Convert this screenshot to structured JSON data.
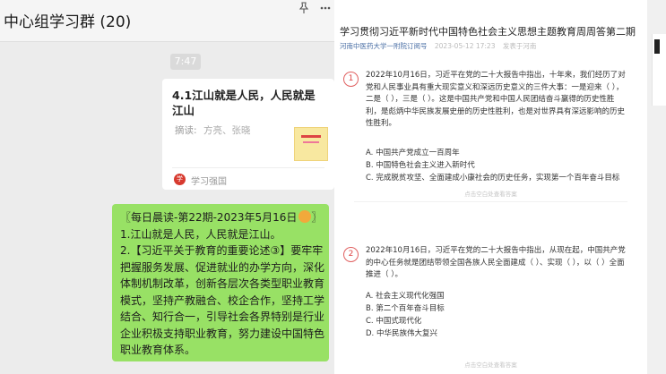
{
  "chat": {
    "title": "中心组学习群 (20)",
    "time": "7:47",
    "card": {
      "title": "4.1江山就是人民，人民就是江山",
      "desc_label": "摘读:",
      "desc": "方亮、张晓",
      "source_icon": "学",
      "source": "学习强国"
    },
    "message": {
      "line1": "〖每日晨读-第22期-2023年5月16日",
      "line1_end": "〗",
      "line2": "1.江山就是人民，人民就是江山。",
      "line3": "2.【习近平关于教育的重要论述③】要牢牢把握服务发展、促进就业的办学方向，深化体制机制改革，创新各层次各类型职业教育模式，坚持产教融合、校企合作，坚持工学结合、知行合一，引导社会各界特别是行业企业积极支持职业教育，努力建设中国特色职业教育体系。"
    }
  },
  "article": {
    "title": "学习贯彻习近平新时代中国特色社会主义思想主题教育周周答第二期",
    "author": "河南中医药大学一附院订阅号",
    "date": "2023-05-12 17:23",
    "location": "发表于河南",
    "questions": [
      {
        "num": "1",
        "text": "2022年10月16日，习近平在党的二十大报告中指出，十年来，我们经历了对党和人民事业具有重大现实意义和深远历史意义的三件大事：一是迎来（ ），二是（ ），三是（ ）。这是中国共产党和中国人民团结奋斗赢得的历史性胜利，是彪炳中华民族发展史册的历史性胜利，也是对世界具有深远影响的历史性胜利。",
        "options": [
          "A. 中国共产党成立一百周年",
          "B. 中国特色社会主义进入新时代",
          "C. 完成脱贫攻坚、全面建成小康社会的历史任务，实现第一个百年奋斗目标"
        ],
        "hint": "点击空白处查看答案"
      },
      {
        "num": "2",
        "text": "2022年10月16日，习近平在党的二十大报告中指出，从现在起，中国共产党的中心任务就是团结带领全国各族人民全面建成（ ）、实现（ ），以（ ）全面推进（ ）。",
        "options": [
          "A. 社会主义现代化强国",
          "B. 第二个百年奋斗目标",
          "C. 中国式现代化",
          "D. 中华民族伟大复兴"
        ],
        "hint": "点击空白处查看答案"
      }
    ]
  },
  "colors": {
    "chat_bg": "#ececec",
    "bubble_green": "#98e165",
    "accent_red": "#d44444",
    "link_blue": "#4a6fa5"
  },
  "icons": [
    "pin-icon",
    "more-icon",
    "source-logo-icon",
    "sun-emoji-icon"
  ]
}
